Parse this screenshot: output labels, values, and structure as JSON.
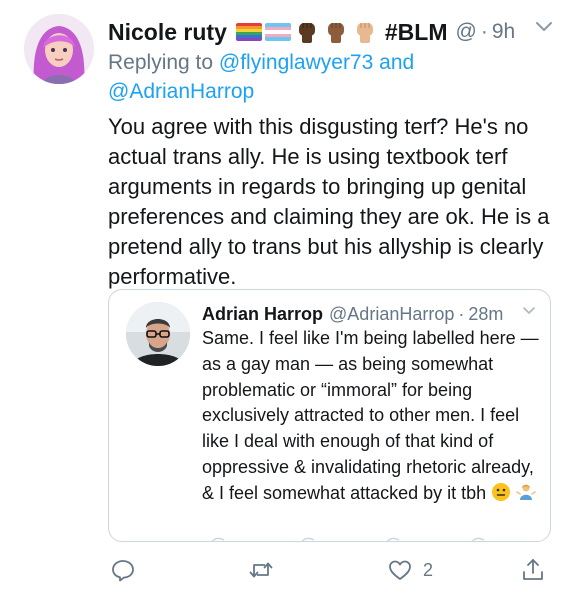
{
  "tweet": {
    "author_name": "Nicole ruty",
    "name_emojis": [
      "rainbow-flag-icon",
      "trans-flag-icon",
      "raised-fist-dark-icon",
      "raised-fist-medium-icon",
      "raised-fist-light-icon"
    ],
    "name_hashtag": "#BLM",
    "handle": "@",
    "separator": "·",
    "time": "9h",
    "reply_prefix": "Replying to",
    "reply_to_1": "@flyinglawyer73",
    "reply_and": "and",
    "reply_to_2": "@AdrianHarrop",
    "text": "You agree with this disgusting terf? He's no actual trans ally. He is using textbook terf arguments in regards to bringing up genital preferences and claiming they are ok. He is a pretend ally to trans but his allyship is clearly performative."
  },
  "quoted": {
    "author_name": "Adrian Harrop",
    "handle": "@AdrianHarrop",
    "separator": "·",
    "time": "28m",
    "text": "Same. I feel like I'm being labelled here — as a gay man — as being somewhat problematic or “immoral” for being exclusively attracted to other men. I feel like I deal with enough of that kind of oppressive & invalidating rhetoric already, & I feel somewhat attacked by it tbh",
    "trailing_emojis": [
      "neutral-face-icon",
      "person-shrugging-icon"
    ]
  },
  "actions": {
    "reply_icon": "reply-icon",
    "retweet_icon": "retweet-icon",
    "like_icon": "heart-icon",
    "like_count": "2",
    "share_icon": "share-icon"
  },
  "colors": {
    "link": "#1da1f2",
    "muted": "#657786",
    "text": "#14171a",
    "border": "#ccd6dd"
  }
}
